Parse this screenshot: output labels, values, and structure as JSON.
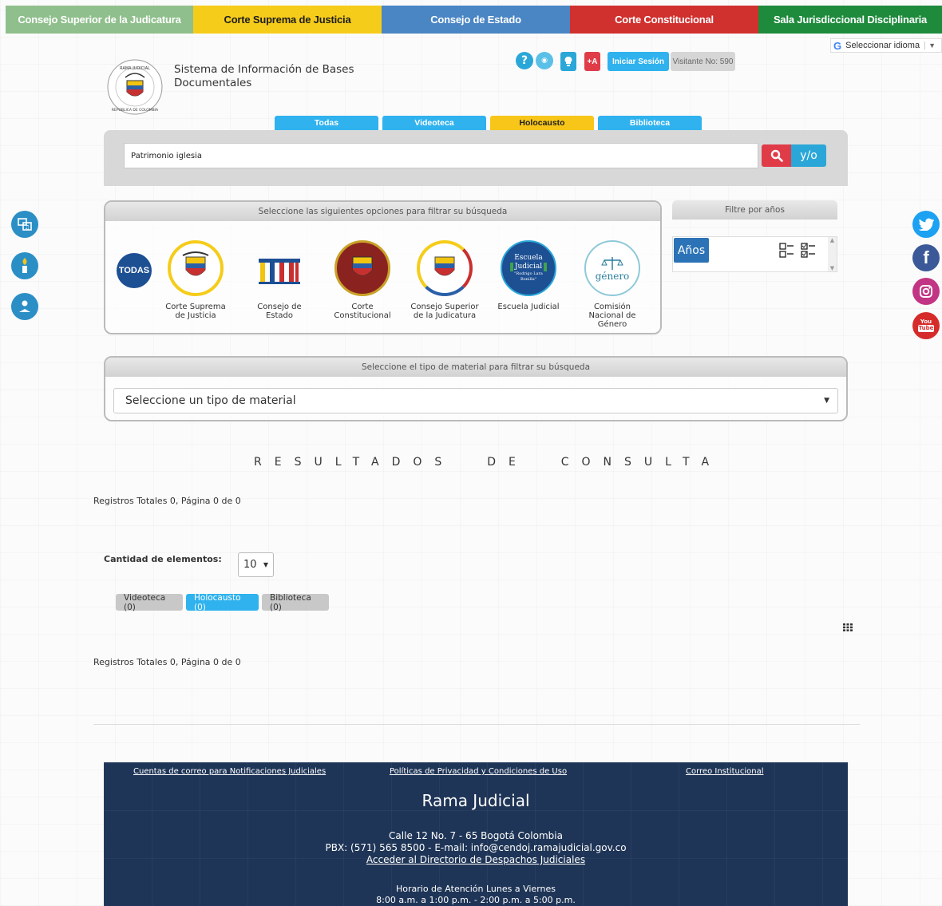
{
  "topnav": [
    {
      "label": "Consejo Superior de la Judicatura",
      "bg": "#8fbf8c",
      "fg": "#ffffff",
      "w": 235
    },
    {
      "label": "Corte Suprema de Justicia",
      "bg": "#f5cc1a",
      "fg": "#1c1c1c",
      "w": 236
    },
    {
      "label": "Consejo de Estado",
      "bg": "#4a85c4",
      "fg": "#ffffff",
      "w": 236
    },
    {
      "label": "Corte Constitucional",
      "bg": "#d0302e",
      "fg": "#ffffff",
      "w": 236
    },
    {
      "label": "Sala Jurisdiccional Disciplinaria",
      "bg": "#1e8a3c",
      "fg": "#ffffff",
      "w": 230
    }
  ],
  "header": {
    "brand_line1": "Sistema de Información de Bases",
    "brand_line2": "Documentales",
    "seal_text": "RAMA JUDICIAL · REPÚBLICA DE COLOMBIA",
    "translate_label": "Seleccionar idioma",
    "help_glyph": "?",
    "sound_glyph": "◉",
    "contrast_glyph": "💡",
    "font_plus": "+A",
    "login_label": "Iniciar Sesión",
    "visitor_label": "Visitante No: 590"
  },
  "tabs": [
    {
      "label": "Todas",
      "bg": "#2fb2ee"
    },
    {
      "label": "Videoteca",
      "bg": "#2fb2ee"
    },
    {
      "label": "Holocausto",
      "bg": "#f7c618",
      "fg": "#222"
    },
    {
      "label": "Biblioteca",
      "bg": "#2fb2ee"
    }
  ],
  "search": {
    "value": "Patrimonio iglesia",
    "yo_label": "y/o"
  },
  "filter_panel": {
    "title": "Seleccione las siguientes opciones para filtrar su búsqueda",
    "todas_label": "TODAS",
    "entities": [
      {
        "label": "Corte Suprema de Justicia"
      },
      {
        "label": "Consejo de Estado"
      },
      {
        "label": "Corte Constitucional"
      },
      {
        "label": "Consejo Superior de la Judicatura"
      },
      {
        "label": "Escuela Judicial"
      },
      {
        "label": "Comisión Nacional de Género"
      }
    ],
    "escuela_logo": {
      "line1": "Escuela",
      "line2": "Judicial",
      "line3": "\"Rodrigo Lara",
      "line4": "Bonilla\""
    },
    "genero_logo": "género"
  },
  "years_panel": {
    "title": "Filtre por años",
    "button": "Años"
  },
  "material_panel": {
    "title": "Seleccione el tipo de material para filtrar su búsqueda",
    "select_value": "Seleccione un tipo de material"
  },
  "results": {
    "heading": "RESULTADOS  DE  CONSULTA",
    "totals_top": "Registros Totales 0, Página 0 de 0",
    "quantity_label": "Cantidad de elementos:",
    "quantity_value": "10",
    "pills": [
      {
        "label": "Videoteca (0)",
        "active": false
      },
      {
        "label": "Holocausto (0)",
        "active": true
      },
      {
        "label": "Biblioteca (0)",
        "active": false
      }
    ],
    "totals_bottom": "Registros Totales 0, Página 0 de 0"
  },
  "footer": {
    "links": [
      "Cuentas de correo para Notificaciones Judiciales",
      "Políticas de Privacidad y Condiciones de Uso",
      "Correo Institucional"
    ],
    "title": "Rama Judicial",
    "address": "Calle 12 No. 7 - 65 Bogotá Colombia",
    "contact": "PBX: (571) 565 8500 - E-mail: info@cendoj.ramajudicial.gov.co",
    "directory_link": "Acceder al Directorio de Despachos Judiciales",
    "hours_title": "Horario de Atención Lunes a Viernes",
    "hours": "8:00 a.m. a 1:00 p.m. - 2:00 p.m. a 5:00 p.m."
  },
  "social": [
    {
      "name": "twitter",
      "glyph": "🐦",
      "bg": "#1da1f2"
    },
    {
      "name": "facebook",
      "glyph": "f",
      "bg": "#3b5998"
    },
    {
      "name": "instagram",
      "glyph": "◎",
      "bg": "#c13584"
    },
    {
      "name": "youtube",
      "glyph": "You Tube",
      "bg": "#d62b2b"
    }
  ]
}
